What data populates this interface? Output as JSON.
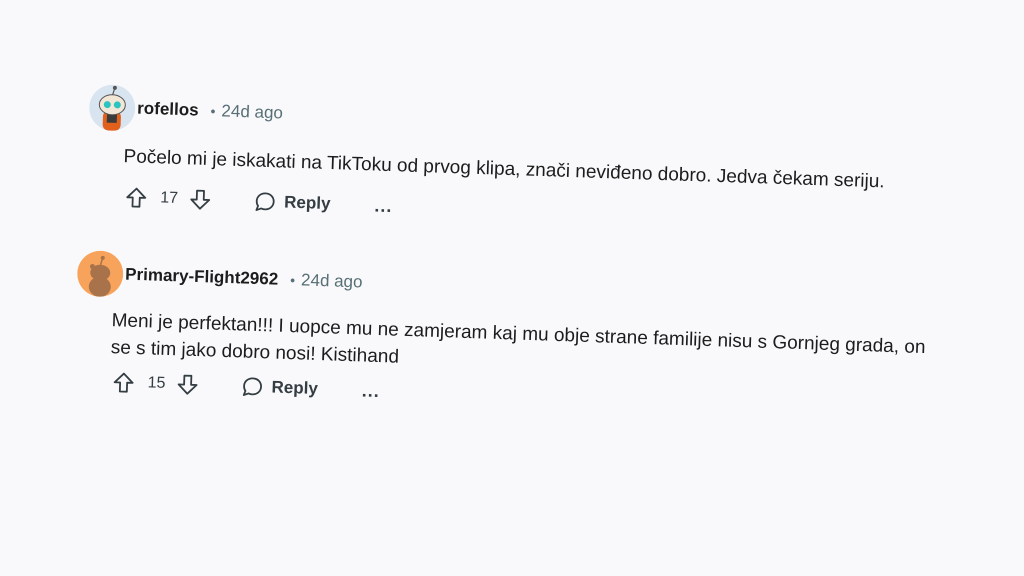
{
  "comments": [
    {
      "username": "rofellos",
      "separator": "•",
      "time": "24d ago",
      "text": "Počelo mi je iskakati na TikToku od prvog klipa, znači neviđeno dobro. Jedva čekam seriju.",
      "score": "17",
      "reply_label": "Reply",
      "more_label": "...",
      "avatar_color": "#d8e4f0"
    },
    {
      "username": "Primary-Flight2962",
      "separator": "•",
      "time": "24d ago",
      "text": "Meni je perfektan!!! I uopce mu ne zamjeram kaj mu obje strane familije nisu s Gornjeg grada, on se s tim jako dobro nosi! Kistihand",
      "score": "15",
      "reply_label": "Reply",
      "more_label": "...",
      "avatar_color": "#f7a35c"
    }
  ],
  "icons": {
    "upvote": "upvote-arrow-icon",
    "downvote": "downvote-arrow-icon",
    "reply": "comment-bubble-icon"
  }
}
